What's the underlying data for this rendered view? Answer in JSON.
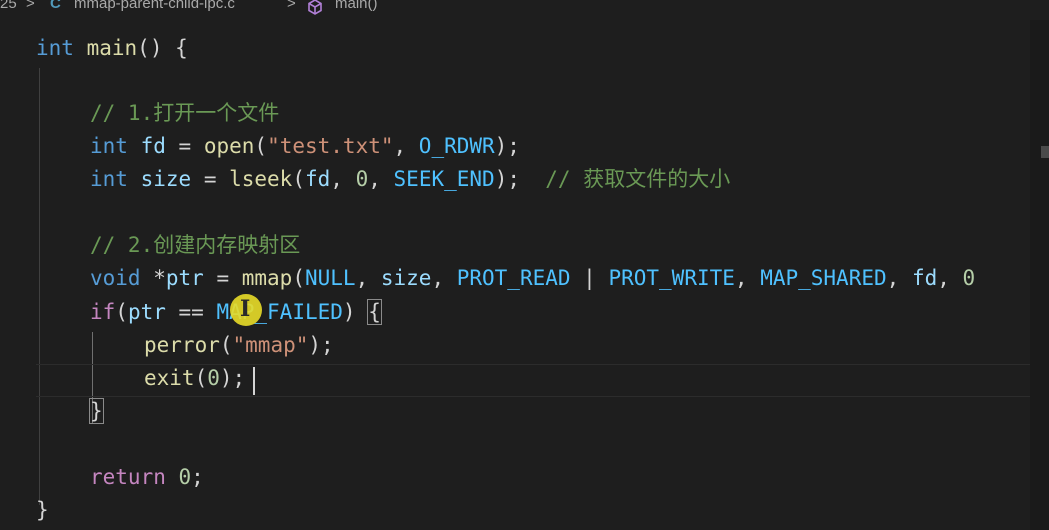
{
  "breadcrumb": {
    "folder": "25",
    "sep1": ">",
    "file_icon": "C",
    "file": "mmap-parent-child-ipc.c",
    "sep2": ">",
    "symbol": "main()"
  },
  "code": {
    "l1": {
      "kw": "int",
      "name": "main",
      "rest": "() {"
    },
    "l3": "// 1.打开一个文件",
    "l4": {
      "kw": "int",
      "v": "fd",
      "eq": " = ",
      "fn": "open",
      "p1": "(",
      "s": "\"test.txt\"",
      "comma": ", ",
      "m": "O_RDWR",
      "end": ");"
    },
    "l5": {
      "kw": "int",
      "v": "size",
      "eq": " = ",
      "fn": "lseek",
      "p1": "(",
      "a1": "fd",
      "c1": ", ",
      "n": "0",
      "c2": ", ",
      "m": "SEEK_END",
      "end": ");",
      "cmt": "  // 获取文件的大小"
    },
    "l7": "// 2.创建内存映射区",
    "l8": {
      "kw": "void",
      "star": " *",
      "v": "ptr",
      "eq": " = ",
      "fn": "mmap",
      "p1": "(",
      "m1": "NULL",
      "c1": ", ",
      "a1": "size",
      "c2": ", ",
      "m2": "PROT_READ",
      "pipe": " | ",
      "m3": "PROT_WRITE",
      "c3": ", ",
      "m4": "MAP_SHARED",
      "c4": ", ",
      "a2": "fd",
      "c5": ", ",
      "n": "0"
    },
    "l9": {
      "kw": "if",
      "p1": "(",
      "v": "ptr",
      "eq": " == ",
      "m": "MAP_FAILED",
      "p2": ") ",
      "br": "{"
    },
    "l10": {
      "fn": "perror",
      "p1": "(",
      "s": "\"mmap\"",
      "end": ");"
    },
    "l11": {
      "fn": "exit",
      "p1": "(",
      "n": "0",
      "end": ");"
    },
    "l12": "}",
    "l14": {
      "kw": "return",
      "sp": " ",
      "n": "0",
      "end": ";"
    },
    "l15": "}"
  },
  "cursor_icon": "text-cursor-icon",
  "colors": {
    "keyword": "#569cd6",
    "control": "#c586c0",
    "function": "#dcdcaa",
    "variable": "#9cdcfe",
    "string": "#ce9178",
    "number": "#b5cea8",
    "macro": "#4fc1ff",
    "comment": "#6a9955",
    "background": "#1e1e1e"
  }
}
